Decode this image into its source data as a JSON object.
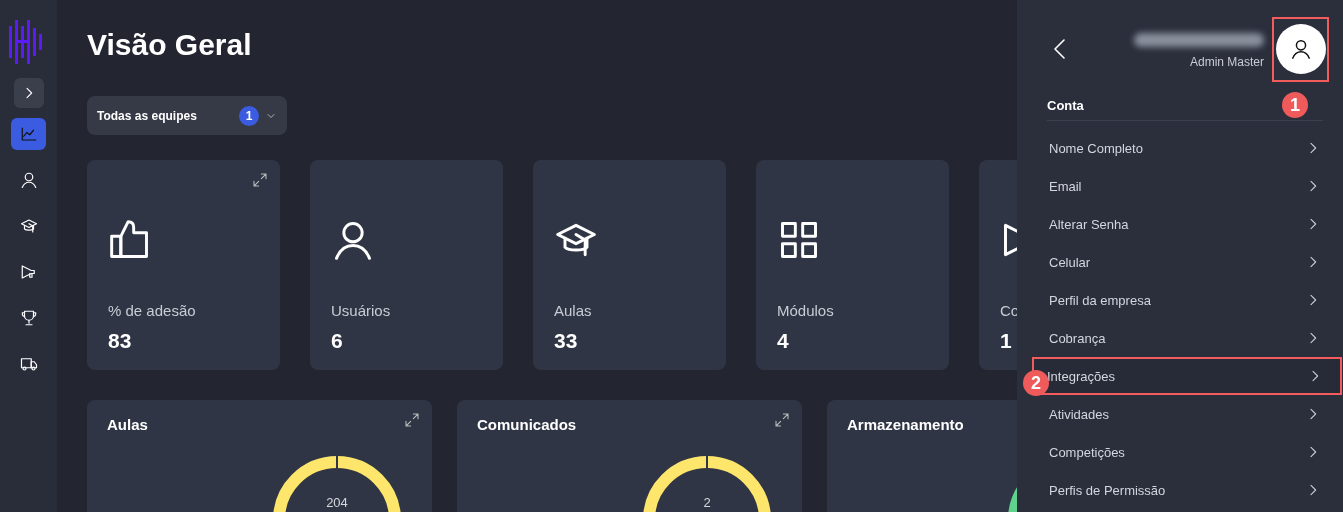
{
  "sidebar": {
    "items": [
      {
        "selected": true
      },
      {
        "selected": false
      },
      {
        "selected": false
      },
      {
        "selected": false
      },
      {
        "selected": false
      },
      {
        "selected": false
      }
    ]
  },
  "page": {
    "title": "Visão Geral"
  },
  "team_filter": {
    "label": "Todas as equipes",
    "count": "1"
  },
  "stat_cards": [
    {
      "label": "% de adesão",
      "value": "83",
      "expandable": true
    },
    {
      "label": "Usuários",
      "value": "6",
      "expandable": false
    },
    {
      "label": "Aulas",
      "value": "33",
      "expandable": false
    },
    {
      "label": "Módulos",
      "value": "4",
      "expandable": false
    },
    {
      "label": "Co",
      "value": "1"
    }
  ],
  "chart_cards": [
    {
      "title": "Aulas",
      "center": "204",
      "color": "#fde66b",
      "expandable": true
    },
    {
      "title": "Comunicados",
      "center": "2",
      "color": "#fde66b",
      "expandable": true
    },
    {
      "title": "Armazenamento",
      "color": "#5fd38d"
    }
  ],
  "account_panel": {
    "role": "Admin Master",
    "section": "Conta",
    "items": [
      {
        "label": "Nome Completo",
        "highlighted": false
      },
      {
        "label": "Email",
        "highlighted": false
      },
      {
        "label": "Alterar Senha",
        "highlighted": false
      },
      {
        "label": "Celular",
        "highlighted": false
      },
      {
        "label": "Perfil da empresa",
        "highlighted": false
      },
      {
        "label": "Cobrança",
        "highlighted": false
      },
      {
        "label": "Integrações",
        "highlighted": true,
        "step": "2"
      },
      {
        "label": "Atividades",
        "highlighted": false
      },
      {
        "label": "Competições",
        "highlighted": false
      },
      {
        "label": "Perfis de Permissão",
        "highlighted": false
      }
    ],
    "avatar_step": "1"
  }
}
